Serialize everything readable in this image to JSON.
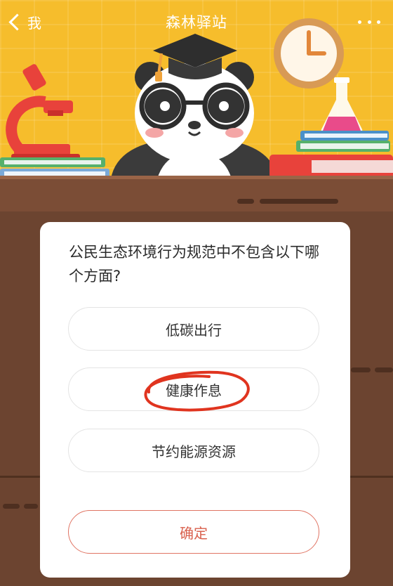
{
  "header": {
    "back_label": "我",
    "title": "森林驿站"
  },
  "quiz": {
    "question": "公民生态环境行为规范中不包含以下哪个方面?",
    "options": [
      "低碳出行",
      "健康作息",
      "节约能源资源"
    ],
    "confirm_label": "确定"
  },
  "colors": {
    "scene_background": "#f6bd2c",
    "wood": "#6c4430",
    "confirm_accent": "#d9604d",
    "annotation_circle": "#e0341f"
  },
  "icons": [
    "back-chevron-icon",
    "more-icon",
    "microscope-icon",
    "panda-mascot",
    "graduation-cap-icon",
    "clock-icon",
    "flask-icon",
    "book-stack-icon"
  ]
}
